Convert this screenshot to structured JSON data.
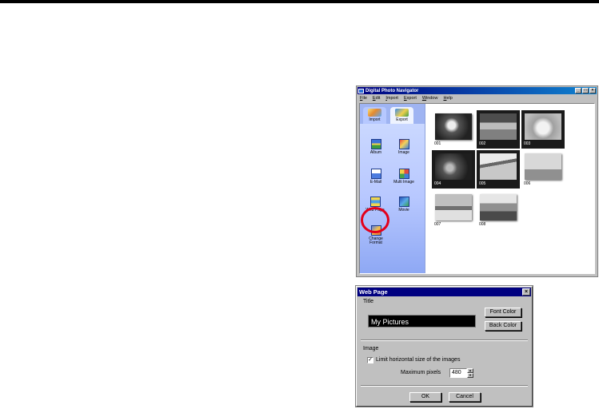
{
  "app": {
    "title": "Digital Photo Navigator",
    "window_buttons": [
      "_",
      "□",
      "×"
    ],
    "menu": [
      "File",
      "Edit",
      "Import",
      "Export",
      "Window",
      "Help"
    ],
    "nav_tabs": [
      "Import",
      "Export"
    ],
    "nav_items": {
      "album": "Album",
      "image": "Image",
      "email": "E-Mail",
      "multi": "Multi Image",
      "web": "Web Page",
      "movie": "Movie",
      "change": "Change Format"
    },
    "thumbnails": [
      "001",
      "002",
      "003",
      "004",
      "005",
      "006",
      "007",
      "008"
    ]
  },
  "dialog": {
    "title": "Web Page",
    "close": "×",
    "title_group": "Title",
    "title_value": "My Pictures",
    "font_color": "Font Color",
    "back_color": "Back Color",
    "image_group": "Image",
    "limit_checked_mark": "✓",
    "limit_label": "Limit horizontal size of the images",
    "max_pixels_label": "Maximum pixels",
    "max_pixels_value": "480",
    "ok": "OK",
    "cancel": "Cancel"
  }
}
